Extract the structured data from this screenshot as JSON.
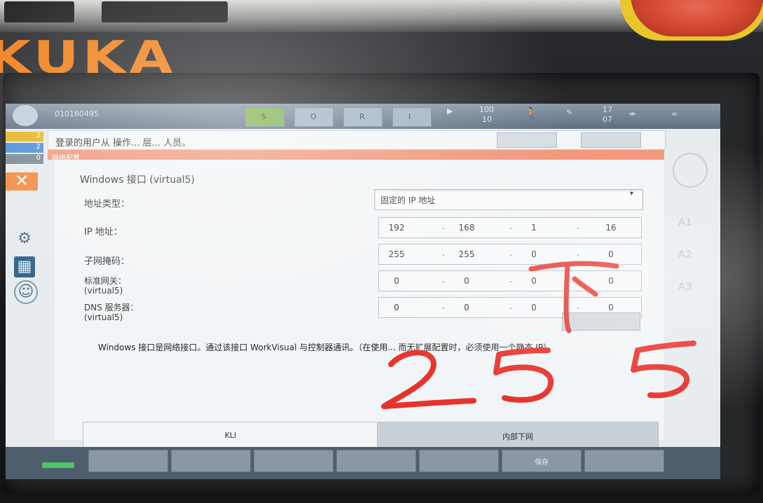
{
  "brand": "KUKA",
  "statusbar": {
    "robot_id": "010160495",
    "indicators": [
      "S",
      "O",
      "R",
      "I"
    ],
    "override": "100",
    "jog": "10",
    "tool": "17",
    "base": "07",
    "counters": [
      "2",
      "2",
      "0"
    ]
  },
  "message_bar": {
    "text": "登录的用户从 操作... 层... 人员。"
  },
  "panel_title": "网络配置",
  "form": {
    "heading": "Windows 接口 (virtual5)",
    "address_type_label": "地址类型：",
    "address_type_value": "固定的 IP 地址",
    "ip_label": "IP 地址：",
    "ip": [
      "192",
      "168",
      "1",
      "16"
    ],
    "subnet_label": "子网掩码：",
    "subnet": [
      "255",
      "255",
      "0",
      "0"
    ],
    "gateway_label": "标准网关：",
    "gateway_sub": "(virtual5)",
    "gateway": [
      "0",
      "0",
      "0",
      "0"
    ],
    "dns_label": "DNS 服务器：",
    "dns_sub": "(virtual5)",
    "dns": [
      "0",
      "0",
      "0",
      "0"
    ],
    "note": "Windows 接口是网络接口。通过该接口 WorkVisual 与控制器通讯。（在使用... 而无扩展配置时，必须使用一个静态 IP）"
  },
  "tabs": [
    "KLI",
    "内部下网"
  ],
  "softkeys": [
    "",
    "",
    "",
    "",
    "",
    "保存",
    ""
  ],
  "axes": [
    "A1",
    "A2",
    "A3"
  ],
  "annotation": {
    "arrow_text": "下",
    "number_text": "255",
    "color": "#e8332c"
  },
  "colors": {
    "brand_orange": "#f07d16",
    "close_button": "#f08a3e",
    "panel_title": "#f1967a"
  }
}
